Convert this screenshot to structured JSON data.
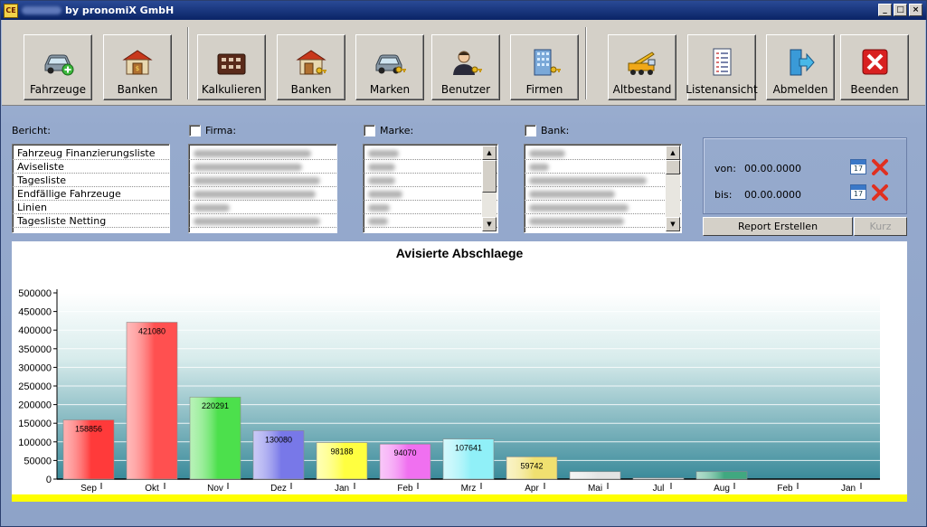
{
  "window": {
    "logo_text": "CE",
    "title": "by pronomiX GmbH",
    "min_glyph": "_",
    "max_glyph": "□",
    "close_glyph": "×"
  },
  "toolbar": {
    "buttons": [
      {
        "label": "Fahrzeuge",
        "icon": "car-add-icon"
      },
      {
        "label": "Banken",
        "icon": "bank-icon"
      },
      {
        "label": "Kalkulieren",
        "icon": "calculator-icon"
      },
      {
        "label": "Banken",
        "icon": "bank-key-icon"
      },
      {
        "label": "Marken",
        "icon": "car-key-icon"
      },
      {
        "label": "Benutzer",
        "icon": "user-key-icon"
      },
      {
        "label": "Firmen",
        "icon": "building-key-icon"
      },
      {
        "label": "Altbestand",
        "icon": "crane-truck-icon"
      },
      {
        "label": "Listenansicht",
        "icon": "list-document-icon"
      },
      {
        "label": "Abmelden",
        "icon": "logout-arrow-icon"
      },
      {
        "label": "Beenden",
        "icon": "exit-x-icon"
      }
    ]
  },
  "filters": {
    "bericht_label": "Bericht:",
    "firma_label": "Firma:",
    "marke_label": "Marke:",
    "bank_label": "Bank:",
    "bericht_items": [
      "Fahrzeug Finanzierungsliste",
      "Aviseliste",
      "Tagesliste",
      "Endfällige Fahrzeuge",
      "Linien",
      "Tagesliste Netting"
    ],
    "scroll_up": "▲",
    "scroll_down": "▼"
  },
  "dates": {
    "von_label": "von:",
    "von_value": "00.00.0000",
    "bis_label": "bis:",
    "bis_value": "00.00.0000",
    "calendar_day": "17",
    "report_button": "Report Erstellen",
    "kurz_button": "Kurz"
  },
  "colors": {
    "window_bg": "#8ea3c8",
    "title_bg": "#0a2466",
    "highlight_band": "#ffff00"
  },
  "chart_data": {
    "type": "bar",
    "title": "Avisierte Abschlaege",
    "categories": [
      "Sep",
      "Okt",
      "Nov",
      "Dez",
      "Jan",
      "Feb",
      "Mrz",
      "Apr",
      "Mai",
      "Jul",
      "Aug",
      "Feb",
      "Jan"
    ],
    "values": [
      158856,
      421080,
      220291,
      130080,
      98188,
      94070,
      107641,
      59742,
      20000,
      3000,
      20000,
      0,
      0
    ],
    "data_labels": [
      "158856",
      "421080",
      "220291",
      "130080",
      "98188",
      "94070",
      "107641",
      "59742",
      "",
      "",
      "",
      "",
      ""
    ],
    "bar_colors": [
      "#ff3a3a",
      "#ff5050",
      "#4ce04c",
      "#7878e8",
      "#ffff40",
      "#f070f0",
      "#90f0f8",
      "#f0e070",
      "#e4e4e4",
      "#e8e8e8",
      "#40a880",
      "#ffffff",
      "#ffffff"
    ],
    "ylim": [
      0,
      500000
    ],
    "yticks": [
      0,
      50000,
      100000,
      150000,
      200000,
      250000,
      300000,
      350000,
      400000,
      450000,
      500000
    ],
    "ytick_labels": [
      "0",
      "50000",
      "100000",
      "150000",
      "200000",
      "250000",
      "300000",
      "350000",
      "400000",
      "450000",
      "500000"
    ],
    "grid": true
  }
}
